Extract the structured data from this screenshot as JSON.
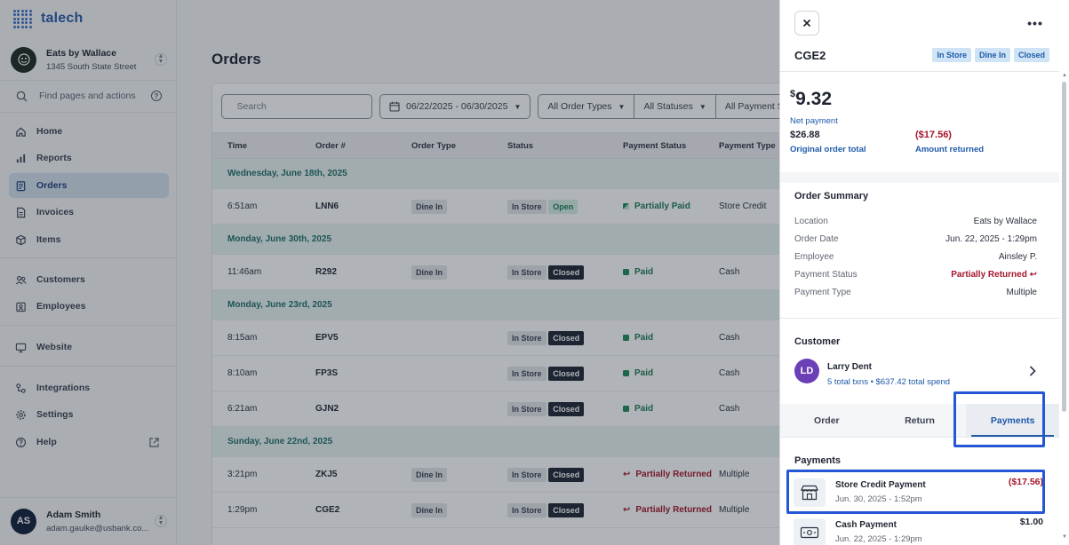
{
  "brand": {
    "name": "talech"
  },
  "business": {
    "name": "Eats by Wallace",
    "address": "1345 South State Street"
  },
  "find": {
    "label": "Find pages and actions",
    "help": "?"
  },
  "nav": {
    "home": "Home",
    "reports": "Reports",
    "orders": "Orders",
    "invoices": "Invoices",
    "items": "Items",
    "customers": "Customers",
    "employees": "Employees",
    "website": "Website",
    "integrations": "Integrations",
    "settings": "Settings",
    "help": "Help"
  },
  "user": {
    "initials": "AS",
    "name": "Adam Smith",
    "email": "adam.gaulke@usbank.co..."
  },
  "main": {
    "title": "Orders",
    "search_placeholder": "Search",
    "date_range": "06/22/2025 - 06/30/2025",
    "filter_order_types": "All Order Types",
    "filter_statuses": "All Statuses",
    "filter_payment_status": "All Payment Stat"
  },
  "table": {
    "headers": {
      "time": "Time",
      "order": "Order #",
      "type": "Order Type",
      "status": "Status",
      "payment_status": "Payment Status",
      "payment_type": "Payment Type"
    },
    "groups": {
      "g1": "Wednesday, June 18th, 2025",
      "g2": "Monday, June 30th, 2025",
      "g3": "Monday, June 23rd, 2025",
      "g4": "Sunday, June 22nd, 2025"
    },
    "rows": [
      {
        "time": "6:51am",
        "order": "LNN6",
        "type": "Dine In",
        "status1": "In Store",
        "status2": "Open",
        "pay_status": "Partially Paid",
        "pay_type": "Store Credit"
      },
      {
        "time": "11:46am",
        "order": "R292",
        "type": "Dine In",
        "status1": "In Store",
        "status2": "Closed",
        "pay_status": "Paid",
        "pay_type": "Cash"
      },
      {
        "time": "8:15am",
        "order": "EPV5",
        "type": "",
        "status1": "In Store",
        "status2": "Closed",
        "pay_status": "Paid",
        "pay_type": "Cash"
      },
      {
        "time": "8:10am",
        "order": "FP3S",
        "type": "",
        "status1": "In Store",
        "status2": "Closed",
        "pay_status": "Paid",
        "pay_type": "Cash"
      },
      {
        "time": "6:21am",
        "order": "GJN2",
        "type": "",
        "status1": "In Store",
        "status2": "Closed",
        "pay_status": "Paid",
        "pay_type": "Cash"
      },
      {
        "time": "3:21pm",
        "order": "ZKJ5",
        "type": "Dine In",
        "status1": "In Store",
        "status2": "Closed",
        "pay_status": "Partially Returned",
        "pay_type": "Multiple"
      },
      {
        "time": "1:29pm",
        "order": "CGE2",
        "type": "Dine In",
        "status1": "In Store",
        "status2": "Closed",
        "pay_status": "Partially Returned",
        "pay_type": "Multiple"
      }
    ]
  },
  "drawer": {
    "order_id": "CGE2",
    "chips": [
      "In Store",
      "Dine In",
      "Closed"
    ],
    "net_currency": "$",
    "net_amount": "9.32",
    "net_label": "Net payment",
    "original_total": "$26.88",
    "original_label": "Original order total",
    "returned_amount": "($17.56)",
    "returned_label": "Amount returned",
    "summary": {
      "title": "Order Summary",
      "location_k": "Location",
      "location_v": "Eats by Wallace",
      "date_k": "Order Date",
      "date_v": "Jun. 22, 2025 - 1:29pm",
      "employee_k": "Employee",
      "employee_v": "Ainsley P.",
      "pstatus_k": "Payment Status",
      "pstatus_v": "Partially Returned",
      "ptype_k": "Payment Type",
      "ptype_v": "Multiple"
    },
    "customer": {
      "title": "Customer",
      "initials": "LD",
      "name": "Larry Dent",
      "meta": "5 total txns • $637.42 total spend"
    },
    "tabs": {
      "order": "Order",
      "return": "Return",
      "payments": "Payments"
    },
    "payments": {
      "title": "Payments",
      "items": [
        {
          "name": "Store Credit Payment",
          "date": "Jun. 30, 2025 - 1:52pm",
          "amount": "($17.56)"
        },
        {
          "name": "Cash Payment",
          "date": "Jun. 22, 2025 - 1:29pm",
          "amount": "$1.00"
        }
      ]
    }
  }
}
